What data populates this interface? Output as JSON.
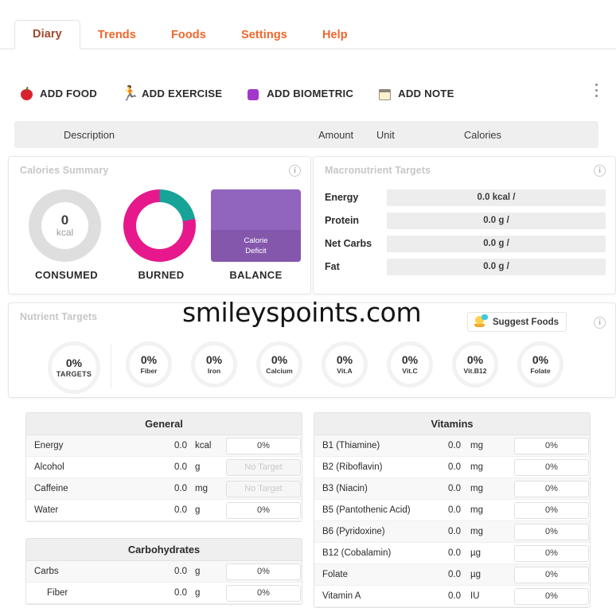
{
  "tabs": [
    {
      "label": "Diary",
      "active": true
    },
    {
      "label": "Trends",
      "active": false
    },
    {
      "label": "Foods",
      "active": false
    },
    {
      "label": "Settings",
      "active": false
    },
    {
      "label": "Help",
      "active": false
    }
  ],
  "actions": [
    {
      "label": "ADD FOOD",
      "icon": "apple-icon"
    },
    {
      "label": "ADD EXERCISE",
      "icon": "runner-icon"
    },
    {
      "label": "ADD BIOMETRIC",
      "icon": "biometric-icon"
    },
    {
      "label": "ADD NOTE",
      "icon": "note-icon"
    }
  ],
  "overflow_menu": "kebab-menu-icon",
  "log_table_header": {
    "description": "Description",
    "amount": "Amount",
    "unit": "Unit",
    "calories": "Calories"
  },
  "calories_summary": {
    "title": "Calories Summary",
    "consumed": {
      "value": "0",
      "unit": "kcal",
      "caption": "CONSUMED",
      "ring_color": "#dedede"
    },
    "burned": {
      "caption": "BURNED",
      "primary_color": "#e6188c",
      "secondary_color": "#17a398",
      "primary_pct": 78,
      "secondary_pct": 22
    },
    "balance": {
      "caption": "BALANCE",
      "line1": "Calorie",
      "line2": "Deficit",
      "color": "#9164bd",
      "lower_color": "#8457ad"
    }
  },
  "macronutrient_targets": {
    "title": "Macronutrient Targets",
    "rows": [
      {
        "label": "Energy",
        "value": "0.0 kcal /"
      },
      {
        "label": "Protein",
        "value": "0.0 g /"
      },
      {
        "label": "Net Carbs",
        "value": "0.0 g /"
      },
      {
        "label": "Fat",
        "value": "0.0 g /"
      }
    ]
  },
  "nutrient_targets": {
    "title": "Nutrient Targets",
    "suggest_button": "Suggest Foods",
    "circles": [
      {
        "pct": "0%",
        "name": "TARGETS"
      },
      {
        "pct": "0%",
        "name": "Fiber"
      },
      {
        "pct": "0%",
        "name": "Iron"
      },
      {
        "pct": "0%",
        "name": "Calcium"
      },
      {
        "pct": "0%",
        "name": "Vit.A"
      },
      {
        "pct": "0%",
        "name": "Vit.C"
      },
      {
        "pct": "0%",
        "name": "Vit.B12"
      },
      {
        "pct": "0%",
        "name": "Folate"
      }
    ]
  },
  "tables": {
    "general": {
      "title": "General",
      "rows": [
        {
          "label": "Energy",
          "value": "0.0",
          "unit": "kcal",
          "target": "0%",
          "no_target": false,
          "indent": false
        },
        {
          "label": "Alcohol",
          "value": "0.0",
          "unit": "g",
          "target": "No Target",
          "no_target": true,
          "indent": false
        },
        {
          "label": "Caffeine",
          "value": "0.0",
          "unit": "mg",
          "target": "No Target",
          "no_target": true,
          "indent": false
        },
        {
          "label": "Water",
          "value": "0.0",
          "unit": "g",
          "target": "0%",
          "no_target": false,
          "indent": false
        }
      ]
    },
    "carbohydrates": {
      "title": "Carbohydrates",
      "rows": [
        {
          "label": "Carbs",
          "value": "0.0",
          "unit": "g",
          "target": "0%",
          "no_target": false,
          "indent": false
        },
        {
          "label": "Fiber",
          "value": "0.0",
          "unit": "g",
          "target": "0%",
          "no_target": false,
          "indent": true
        }
      ]
    },
    "vitamins": {
      "title": "Vitamins",
      "rows": [
        {
          "label": "B1 (Thiamine)",
          "value": "0.0",
          "unit": "mg",
          "target": "0%",
          "no_target": false,
          "indent": false
        },
        {
          "label": "B2 (Riboflavin)",
          "value": "0.0",
          "unit": "mg",
          "target": "0%",
          "no_target": false,
          "indent": false
        },
        {
          "label": "B3 (Niacin)",
          "value": "0.0",
          "unit": "mg",
          "target": "0%",
          "no_target": false,
          "indent": false
        },
        {
          "label": "B5 (Pantothenic Acid)",
          "value": "0.0",
          "unit": "mg",
          "target": "0%",
          "no_target": false,
          "indent": false
        },
        {
          "label": "B6 (Pyridoxine)",
          "value": "0.0",
          "unit": "mg",
          "target": "0%",
          "no_target": false,
          "indent": false
        },
        {
          "label": "B12 (Cobalamin)",
          "value": "0.0",
          "unit": "µg",
          "target": "0%",
          "no_target": false,
          "indent": false
        },
        {
          "label": "Folate",
          "value": "0.0",
          "unit": "µg",
          "target": "0%",
          "no_target": false,
          "indent": false
        },
        {
          "label": "Vitamin A",
          "value": "0.0",
          "unit": "IU",
          "target": "0%",
          "no_target": false,
          "indent": false
        }
      ]
    }
  },
  "watermark": "smileyspoints.com",
  "info_icon": "info-icon"
}
